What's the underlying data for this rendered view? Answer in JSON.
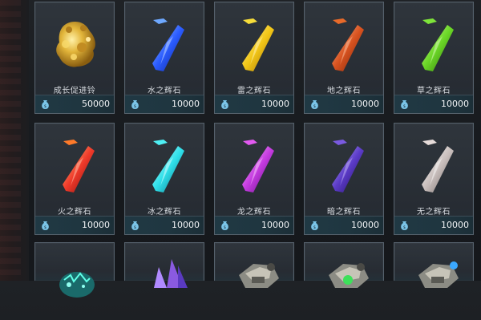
{
  "shop": {
    "items": [
      {
        "name": "成长促进铃",
        "price": "50000",
        "icon": "gold-bell-icon",
        "color": "#d6a526"
      },
      {
        "name": "水之辉石",
        "price": "10000",
        "icon": "water-crystal-icon",
        "color": "#2a5bff"
      },
      {
        "name": "雷之辉石",
        "price": "10000",
        "icon": "thunder-crystal-icon",
        "color": "#f2c617"
      },
      {
        "name": "地之辉石",
        "price": "10000",
        "icon": "earth-crystal-icon",
        "color": "#d8521f"
      },
      {
        "name": "草之辉石",
        "price": "10000",
        "icon": "grass-crystal-icon",
        "color": "#6ad626"
      },
      {
        "name": "火之辉石",
        "price": "10000",
        "icon": "fire-crystal-icon",
        "color": "#f03a2a"
      },
      {
        "name": "冰之辉石",
        "price": "10000",
        "icon": "ice-crystal-icon",
        "color": "#2fe0ea"
      },
      {
        "name": "龙之辉石",
        "price": "10000",
        "icon": "dragon-crystal-icon",
        "color": "#c53be0"
      },
      {
        "name": "暗之辉石",
        "price": "10000",
        "icon": "dark-crystal-icon",
        "color": "#5b3bc8"
      },
      {
        "name": "无之辉石",
        "price": "10000",
        "icon": "neutral-crystal-icon",
        "color": "#c9bfbd"
      }
    ],
    "partial_items": [
      {
        "icon": "teal-orb-icon"
      },
      {
        "icon": "purple-crystal-cluster-icon"
      },
      {
        "icon": "mechanical-device-icon"
      },
      {
        "icon": "green-mechanical-device-icon"
      },
      {
        "icon": "blue-mechanical-device-icon"
      }
    ]
  }
}
